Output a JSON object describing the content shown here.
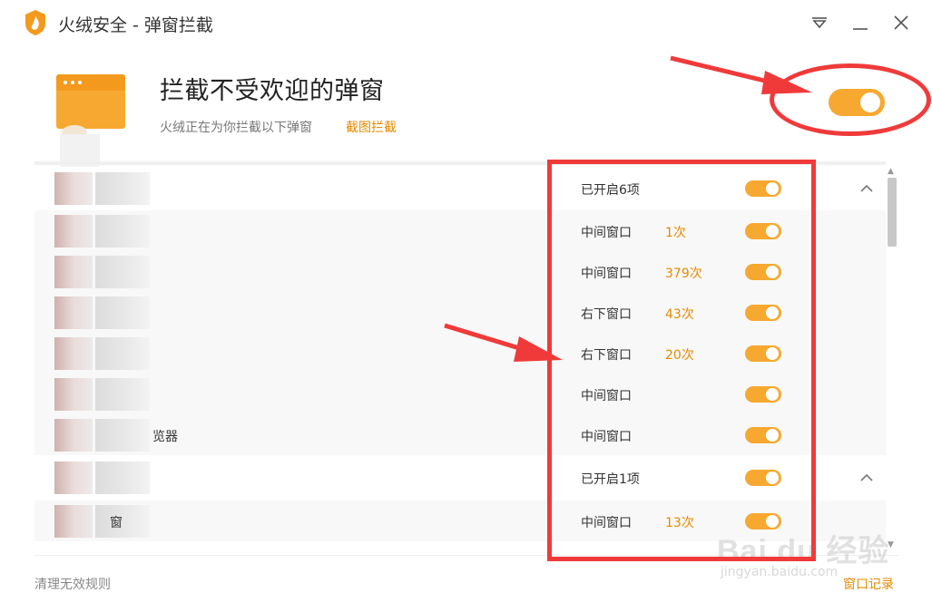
{
  "window": {
    "title": "火绒安全 - 弹窗拦截",
    "controls": [
      "menu-dropdown",
      "minimize",
      "close"
    ]
  },
  "header": {
    "title": "拦截不受欢迎的弹窗",
    "subtitle": "火绒正在为你拦截以下弹窗",
    "link": "截图拦截",
    "master_toggle_on": true
  },
  "list": {
    "rows": [
      {
        "type": "group",
        "status": "已开启6项",
        "count": "",
        "enabled": true,
        "collapsible": true,
        "suffix": ""
      },
      {
        "type": "item",
        "label": "中间窗口",
        "count": "1次",
        "enabled": true,
        "suffix": ""
      },
      {
        "type": "item",
        "label": "中间窗口",
        "count": "379次",
        "enabled": true,
        "suffix": ""
      },
      {
        "type": "item",
        "label": "右下窗口",
        "count": "43次",
        "enabled": true,
        "suffix": ""
      },
      {
        "type": "item",
        "label": "右下窗口",
        "count": "20次",
        "enabled": true,
        "suffix": ""
      },
      {
        "type": "item",
        "label": "中间窗口",
        "count": "",
        "enabled": true,
        "suffix": ""
      },
      {
        "type": "item",
        "label": "中间窗口",
        "count": "",
        "enabled": true,
        "suffix": "览器"
      },
      {
        "type": "group",
        "status": "已开启1项",
        "count": "",
        "enabled": true,
        "collapsible": true,
        "suffix": ""
      },
      {
        "type": "item",
        "label": "中间窗口",
        "count": "13次",
        "enabled": true,
        "suffix": "窗"
      }
    ]
  },
  "footer": {
    "left_link": "清理无效规则",
    "right_link": "窗口记录"
  },
  "watermark": {
    "main": "Bai du 经验",
    "sub": "jingyan.baidu.com"
  },
  "colors": {
    "accent": "#f7a830",
    "link": "#e48a00",
    "annotation": "#f03a3a",
    "row_alt_bg": "#f8f8f8"
  }
}
